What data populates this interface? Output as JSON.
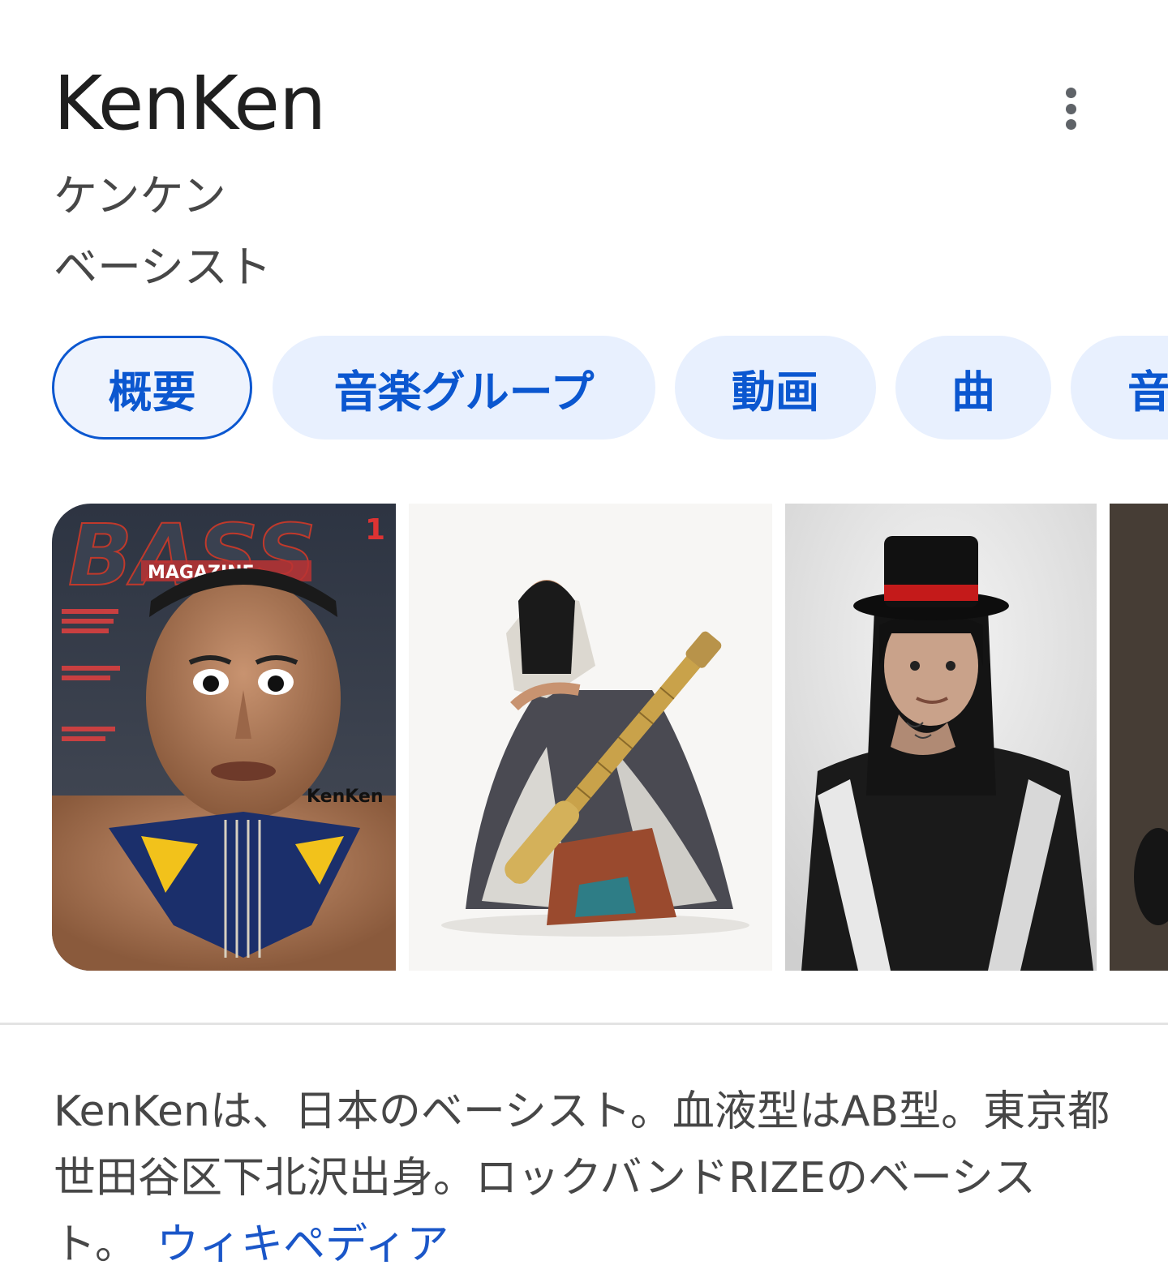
{
  "entity": {
    "title": "KenKen",
    "reading": "ケンケン",
    "occupation": "ベーシスト"
  },
  "menu": {
    "icon": "more-vert-icon"
  },
  "chips": [
    {
      "label": "概要",
      "selected": true
    },
    {
      "label": "音楽グループ",
      "selected": false
    },
    {
      "label": "動画",
      "selected": false
    },
    {
      "label": "曲",
      "selected": false
    },
    {
      "label": "音",
      "selected": false
    }
  ],
  "images": {
    "magazine_cover": {
      "masthead": "BASS",
      "sub_masthead": "MAGAZINE",
      "issue": "1",
      "cover_name": "KenKen"
    }
  },
  "description": {
    "text": "KenKenは、日本のベーシスト。血液型はAB型。東京都世田谷区下北沢出身。ロックバンドRIZEのベーシスト。",
    "source_link": "ウィキペディア"
  },
  "colors": {
    "chip_text": "#0b57d0",
    "chip_bg": "#e8f0fe",
    "link": "#1a56c8"
  }
}
